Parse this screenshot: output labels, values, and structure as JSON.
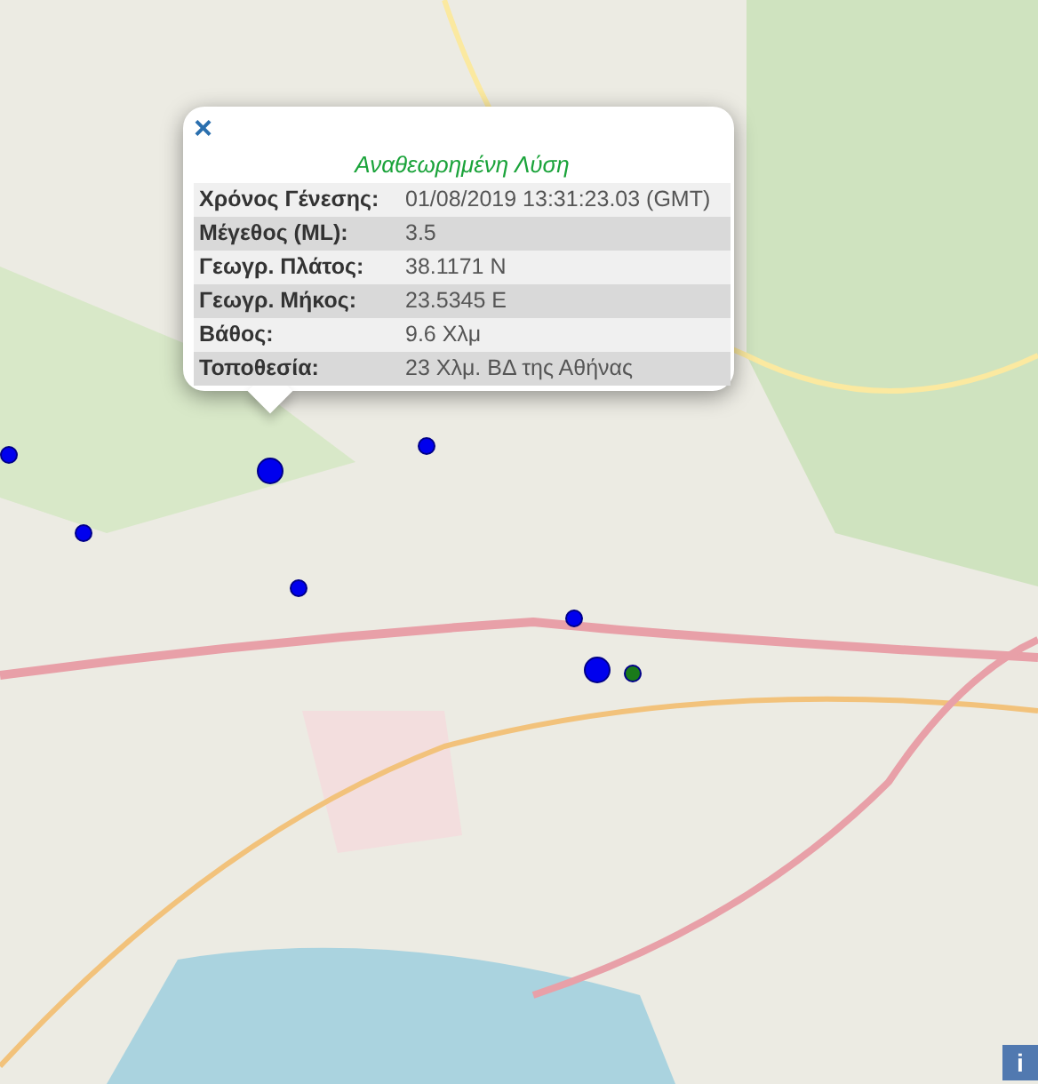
{
  "map": {
    "markers": [
      {
        "kind": "small",
        "color": "#0000ee"
      },
      {
        "kind": "large",
        "color": "#0000ee"
      },
      {
        "kind": "small",
        "color": "#0000ee"
      },
      {
        "kind": "small",
        "color": "#0000ee"
      },
      {
        "kind": "small",
        "color": "#0000ee"
      },
      {
        "kind": "small",
        "color": "#0000ee"
      },
      {
        "kind": "large",
        "color": "#0000ee"
      },
      {
        "kind": "small",
        "color": "#1a7a1a"
      }
    ]
  },
  "popup": {
    "close": "×",
    "title": "Αναθεωρημένη Λύση",
    "rows": [
      {
        "label": "Χρόνος Γένεσης:",
        "value": "01/08/2019 13:31:23.03 (GMT)"
      },
      {
        "label": "Μέγεθος (ML):",
        "value": "3.5"
      },
      {
        "label": "Γεωγρ. Πλάτος:",
        "value": "38.1171 N"
      },
      {
        "label": "Γεωγρ. Μήκος:",
        "value": "23.5345 E"
      },
      {
        "label": "Βάθος:",
        "value": "9.6 Χλμ"
      },
      {
        "label": "Τοποθεσία:",
        "value": "23 Χλμ. ΒΔ της Αθήνας"
      }
    ]
  },
  "info_button": {
    "label": "i"
  }
}
